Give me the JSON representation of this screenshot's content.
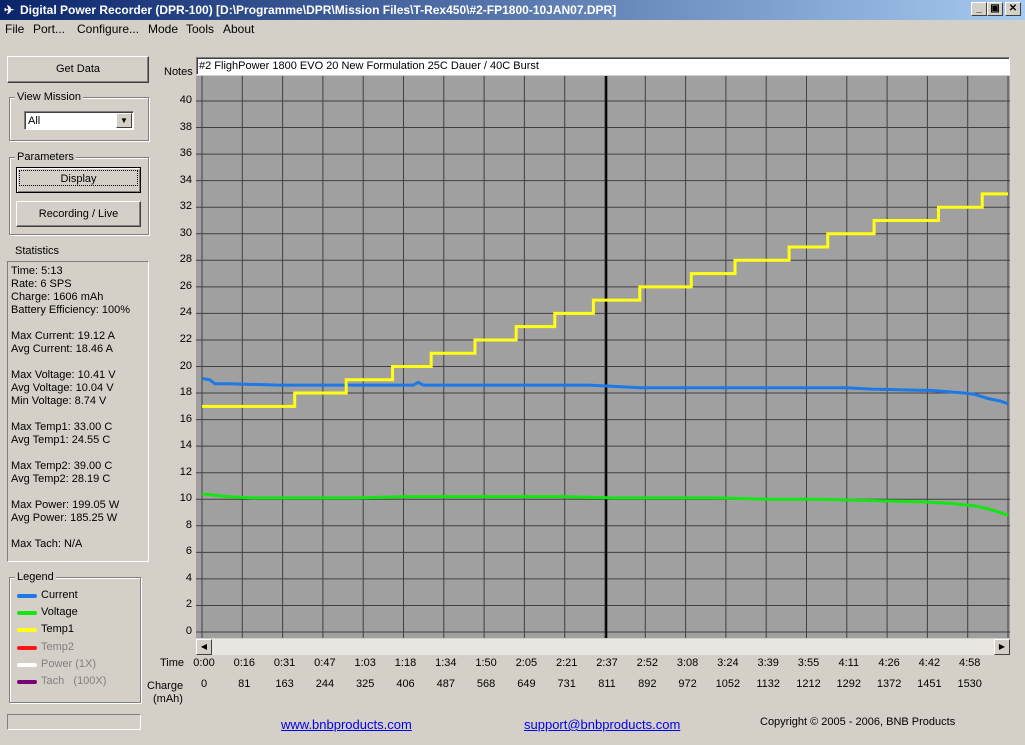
{
  "window": {
    "title": "Digital Power Recorder (DPR-100) [D:\\Programme\\DPR\\Mission Files\\T-Rex450\\#2-FP1800-10JAN07.DPR]",
    "min_glyph": "_",
    "max_glyph": "▣",
    "close_glyph": "✕"
  },
  "menu": [
    "File",
    "Port...",
    "Configure...",
    "Mode",
    "Tools",
    "About"
  ],
  "left_panel": {
    "get_data_label": "Get Data",
    "view_mission_label": "View Mission",
    "view_mission_value": "All",
    "parameters_label": "Parameters",
    "display_label": "Display",
    "recording_label": "Recording / Live",
    "statistics_label": "Statistics",
    "stats": [
      "Time: 5:13",
      "Rate: 6 SPS",
      "Charge: 1606 mAh",
      "Battery Efficiency: 100%",
      "Max Current: 19.12 A",
      "Avg Current: 18.46 A",
      "Max Voltage: 10.41 V",
      "Avg Voltage: 10.04 V",
      "Min Voltage: 8.74 V",
      "Max Temp1: 33.00 C",
      "Avg Temp1: 24.55 C",
      "Max Temp2: 39.00 C",
      "Avg Temp2: 28.19 C",
      "Max Power: 199.05 W",
      "Avg Power: 185.25 W",
      "Max Tach: N/A"
    ],
    "legend_label": "Legend",
    "legend": [
      {
        "label": "Current",
        "color": "#1e78e6",
        "active": true
      },
      {
        "label": "Voltage",
        "color": "#14e614",
        "active": true
      },
      {
        "label": "Temp1",
        "color": "#ffff14",
        "active": true
      },
      {
        "label": "Temp2",
        "color": "#ff1414",
        "active": false
      },
      {
        "label": "Power (1X)",
        "color": "#ffffff",
        "active": false
      },
      {
        "label": "Tach   (100X)",
        "color": "#780078",
        "active": false
      }
    ]
  },
  "notes": {
    "label": "Notes",
    "value": "#2 FlighPower 1800 EVO 20 New Formulation 25C Dauer / 40C Burst"
  },
  "axis": {
    "time_caption": "Time",
    "charge_caption": "Charge",
    "charge_unit": "(mAh)"
  },
  "footer": {
    "website": "www.bnbproducts.com",
    "email": "support@bnbproducts.com",
    "copyright": "Copyright © 2005 - 2006, BNB Products"
  },
  "chart_data": {
    "type": "line",
    "ylim": [
      0,
      40
    ],
    "yticks": [
      0,
      2,
      4,
      6,
      8,
      10,
      12,
      14,
      16,
      18,
      20,
      22,
      24,
      26,
      28,
      30,
      32,
      34,
      36,
      38,
      40
    ],
    "xlim": [
      0,
      313
    ],
    "x_unit": "seconds",
    "time_ticks": [
      "0:00",
      "0:16",
      "0:31",
      "0:47",
      "1:03",
      "1:18",
      "1:34",
      "1:50",
      "2:05",
      "2:21",
      "2:37",
      "2:52",
      "3:08",
      "3:24",
      "3:39",
      "3:55",
      "4:11",
      "4:26",
      "4:42",
      "4:58"
    ],
    "charge_ticks": [
      "0",
      "81",
      "163",
      "244",
      "325",
      "406",
      "487",
      "568",
      "649",
      "731",
      "811",
      "892",
      "972",
      "1052",
      "1132",
      "1212",
      "1292",
      "1372",
      "1451",
      "1530"
    ],
    "cursor_x": 157,
    "grid": true,
    "series": [
      {
        "name": "Current",
        "color": "#1e78e6",
        "x": [
          0,
          3,
          5,
          10,
          30,
          60,
          82,
          84,
          86,
          100,
          150,
          160,
          170,
          250,
          260,
          280,
          283,
          296,
          300,
          305,
          310,
          313
        ],
        "y": [
          19.1,
          19.0,
          18.7,
          18.7,
          18.6,
          18.6,
          18.6,
          18.8,
          18.6,
          18.6,
          18.6,
          18.5,
          18.4,
          18.4,
          18.3,
          18.2,
          18.2,
          18.0,
          17.9,
          17.6,
          17.4,
          17.2
        ]
      },
      {
        "name": "Voltage",
        "color": "#14e614",
        "x": [
          0,
          10,
          20,
          40,
          60,
          80,
          100,
          120,
          140,
          160,
          180,
          200,
          220,
          240,
          260,
          280,
          290,
          300,
          305,
          310,
          313
        ],
        "y": [
          10.4,
          10.2,
          10.1,
          10.1,
          10.1,
          10.2,
          10.2,
          10.2,
          10.2,
          10.1,
          10.1,
          10.1,
          10.0,
          10.0,
          9.9,
          9.8,
          9.7,
          9.5,
          9.3,
          9.0,
          8.8
        ]
      },
      {
        "name": "Temp1",
        "color": "#ffff14",
        "steps": [
          [
            0,
            17
          ],
          [
            36,
            18
          ],
          [
            56,
            19
          ],
          [
            74,
            20
          ],
          [
            89,
            21
          ],
          [
            106,
            22
          ],
          [
            122,
            23
          ],
          [
            137,
            24
          ],
          [
            152,
            25
          ],
          [
            170,
            26
          ],
          [
            190,
            27
          ],
          [
            207,
            28
          ],
          [
            228,
            29
          ],
          [
            243,
            30
          ],
          [
            261,
            31
          ],
          [
            286,
            32
          ],
          [
            303,
            33
          ],
          [
            313,
            33
          ]
        ]
      }
    ]
  }
}
